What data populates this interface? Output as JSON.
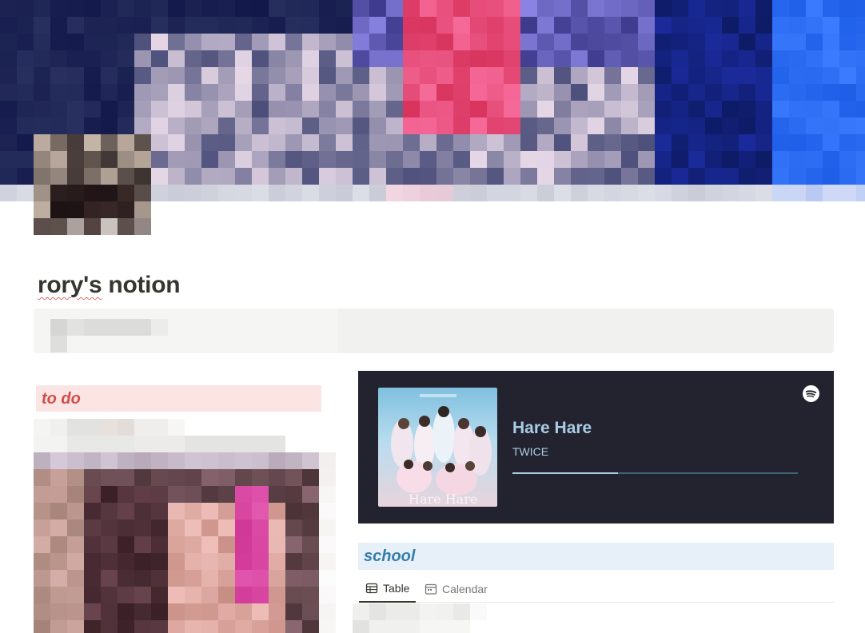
{
  "page": {
    "title_word": "rory's",
    "title_rest": " notion"
  },
  "sections": {
    "todo_heading": "to do",
    "school_heading": "school"
  },
  "spotify": {
    "track": "Hare Hare",
    "artist": "TWICE",
    "progress": 0.37,
    "logo_icon": "spotify-icon"
  },
  "school_views": {
    "tabs": [
      {
        "label": "Table",
        "icon": "table-icon",
        "active": true
      },
      {
        "label": "Calendar",
        "icon": "calendar-icon",
        "active": false
      }
    ]
  },
  "colors": {
    "todo_bg": "#fbe4e4",
    "todo_text": "#d44c47",
    "school_bg": "#e7f0f8",
    "school_text": "#337ea9",
    "spotify_bg": "#23232f",
    "spotify_text": "#a9cde4"
  }
}
